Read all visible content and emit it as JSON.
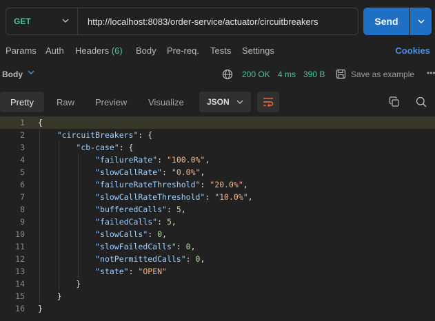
{
  "request": {
    "method": "GET",
    "url": "http://localhost:8083/order-service/actuator/circuitbreakers",
    "send_label": "Send"
  },
  "req_tabs": {
    "params": "Params",
    "auth": "Auth",
    "headers": "Headers",
    "headers_count": "(6)",
    "body": "Body",
    "prereq": "Pre-req.",
    "tests": "Tests",
    "settings": "Settings",
    "cookies": "Cookies"
  },
  "response": {
    "body_label": "Body",
    "status": "200 OK",
    "time": "4 ms",
    "size": "390 B",
    "save_example": "Save as example",
    "more": "•••"
  },
  "view_tabs": {
    "pretty": "Pretty",
    "raw": "Raw",
    "preview": "Preview",
    "visualize": "Visualize",
    "format": "JSON"
  },
  "code_lines": [
    {
      "n": "1",
      "text": "{"
    },
    {
      "n": "2",
      "text": "    \"circuitBreakers\": {"
    },
    {
      "n": "3",
      "text": "        \"cb-case\": {"
    },
    {
      "n": "4",
      "text": "            \"failureRate\": \"100.0%\","
    },
    {
      "n": "5",
      "text": "            \"slowCallRate\": \"0.0%\","
    },
    {
      "n": "6",
      "text": "            \"failureRateThreshold\": \"20.0%\","
    },
    {
      "n": "7",
      "text": "            \"slowCallRateThreshold\": \"10.0%\","
    },
    {
      "n": "8",
      "text": "            \"bufferedCalls\": 5,"
    },
    {
      "n": "9",
      "text": "            \"failedCalls\": 5,"
    },
    {
      "n": "10",
      "text": "            \"slowCalls\": 0,"
    },
    {
      "n": "11",
      "text": "            \"slowFailedCalls\": 0,"
    },
    {
      "n": "12",
      "text": "            \"notPermittedCalls\": 0,"
    },
    {
      "n": "13",
      "text": "            \"state\": \"OPEN\""
    },
    {
      "n": "14",
      "text": "        }"
    },
    {
      "n": "15",
      "text": "    }"
    },
    {
      "n": "16",
      "text": "}"
    }
  ],
  "colors": {
    "accent": "#1f6fc5",
    "success": "#4fc3a1",
    "link": "#4a90e2"
  }
}
